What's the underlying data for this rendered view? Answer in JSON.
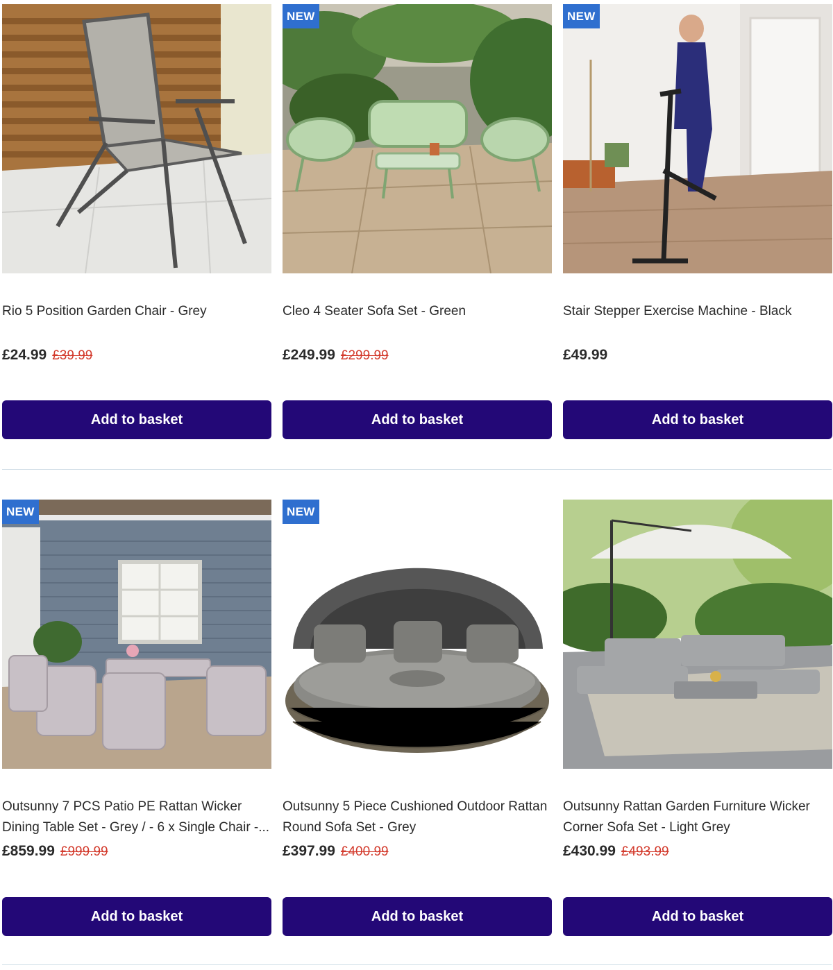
{
  "products": [
    {
      "badge": "",
      "title": "Rio 5 Position Garden Chair - Grey",
      "price": "£24.99",
      "was_price": "£39.99",
      "button_label": "Add to basket",
      "image": "garden-chair-photo"
    },
    {
      "badge": "NEW",
      "title": "Cleo 4 Seater Sofa Set - Green",
      "price": "£249.99",
      "was_price": "£299.99",
      "button_label": "Add to basket",
      "image": "sofa-set-photo"
    },
    {
      "badge": "NEW",
      "title": "Stair Stepper Exercise Machine - Black",
      "price": "£49.99",
      "was_price": "",
      "button_label": "Add to basket",
      "image": "stair-stepper-photo"
    },
    {
      "badge": "NEW",
      "title": "Outsunny 7 PCS Patio PE Rattan Wicker Dining Table Set - Grey / - 6 x Single Chair -...",
      "price": "£859.99",
      "was_price": "£999.99",
      "button_label": "Add to basket",
      "image": "rattan-dining-set-photo"
    },
    {
      "badge": "NEW",
      "title": "Outsunny 5 Piece Cushioned Outdoor Rattan Round Sofa Set - Grey",
      "price": "£397.99",
      "was_price": "£400.99",
      "button_label": "Add to basket",
      "image": "round-daybed-photo"
    },
    {
      "badge": "",
      "title": "Outsunny Rattan Garden Furniture Wicker Corner Sofa Set - Light Grey",
      "price": "£430.99",
      "was_price": "£493.99",
      "button_label": "Add to basket",
      "image": "corner-sofa-photo"
    }
  ],
  "colors": {
    "button": "#230877",
    "badge": "#2f6fcf",
    "was_price": "#d33a2c",
    "divider": "#cfdde6"
  }
}
